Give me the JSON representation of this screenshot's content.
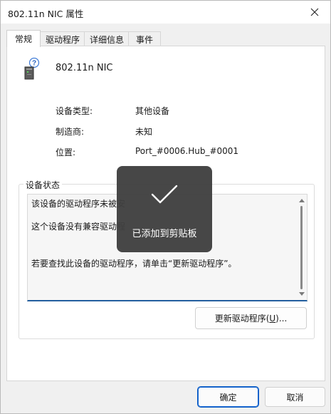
{
  "window": {
    "title": "802.11n NIC 属性",
    "close_icon": "close-icon"
  },
  "tabs": [
    {
      "label": "常规",
      "active": true
    },
    {
      "label": "驱动程序",
      "active": false
    },
    {
      "label": "详细信息",
      "active": false
    },
    {
      "label": "事件",
      "active": false
    }
  ],
  "general": {
    "device_icon": "unknown-device-icon",
    "device_name": "802.11n NIC",
    "rows": [
      {
        "label": "设备类型:",
        "value": "其他设备"
      },
      {
        "label": "制造商:",
        "value": "未知"
      },
      {
        "label": "位置:",
        "value": "Port_#0006.Hub_#0001"
      }
    ],
    "status_group_label": "设备状态",
    "status_lines": [
      "该设备的驱动程序未被安",
      "这个设备没有兼容驱动程",
      "若要查找此设备的驱动程序，请单击“更新驱动程序”。"
    ],
    "update_driver_prefix": "更新驱动程序(",
    "update_driver_key": "U",
    "update_driver_suffix": ")..."
  },
  "footer": {
    "ok_label": "确定",
    "cancel_label": "取消"
  },
  "toast": {
    "icon": "checkmark-icon",
    "text": "已添加到剪贴板"
  },
  "colors": {
    "accent": "#0a5bc4",
    "status_underline": "#235e9e",
    "toast_bg": "#404040"
  }
}
